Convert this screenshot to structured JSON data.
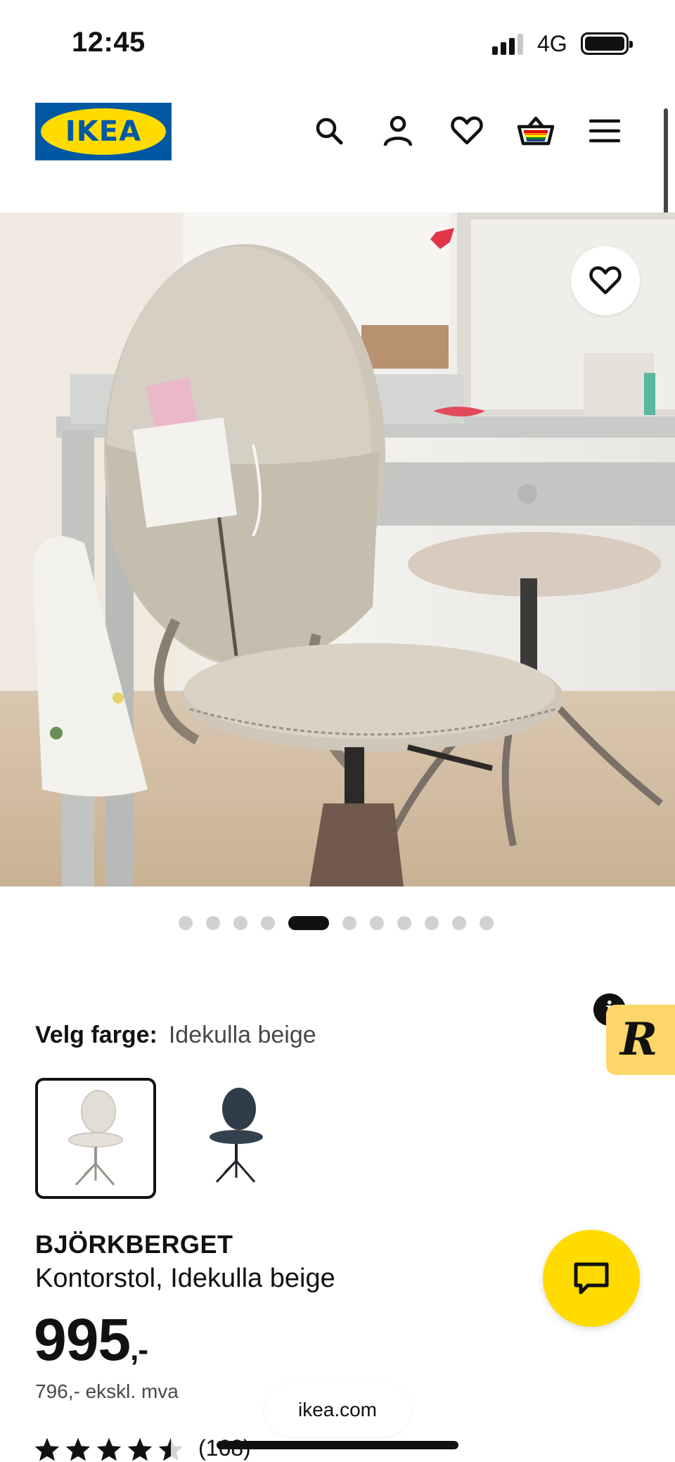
{
  "status_bar": {
    "time": "12:45",
    "network": "4G"
  },
  "brand": {
    "logo_text": "IKEA"
  },
  "header": {
    "icons": [
      "search-icon",
      "account-icon",
      "heart-icon",
      "basket-icon",
      "menu-icon"
    ]
  },
  "gallery": {
    "image_count": 11,
    "active_index": 4
  },
  "color_select": {
    "label": "Velg farge:",
    "selected": "Idekulla beige",
    "options": [
      {
        "name": "Idekulla beige",
        "color": "#d9d4cb"
      },
      {
        "name": "blue",
        "color": "#2f3d4a"
      }
    ]
  },
  "product": {
    "name": "BJÖRKBERGET",
    "description": "Kontorstol, Idekulla beige",
    "price": "995",
    "price_suffix": ",-",
    "price_ex_vat": "796,- ekskl. mva",
    "rating": 4.5,
    "review_count": "(168)"
  },
  "browser": {
    "url": "ikea.com"
  },
  "colors": {
    "ikea_blue": "#0058a3",
    "ikea_yellow": "#ffdb00",
    "badge_yellow": "#fdd66a"
  }
}
